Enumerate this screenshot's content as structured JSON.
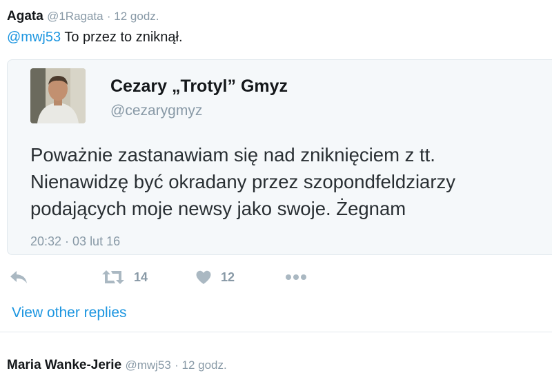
{
  "reply_tweet": {
    "author_name": "Agata",
    "author_handle": "@1Ragata",
    "time": "· 12 godz.",
    "mention": "@mwj53",
    "text": "To przez to zniknął."
  },
  "quoted_tweet": {
    "author_name": "Cezary „Trotyl” Gmyz",
    "author_handle": "@cezarygmyz",
    "body_lines": [
      "Poważnie zastanawiam się nad zniknięciem z tt.",
      "Nienawidzę być okradany przez szopondfeldziarzy",
      "podających moje newsy jako swoje. Żegnam"
    ],
    "timestamp": "20:32 · 03 lut 16"
  },
  "actions": {
    "reply_icon": "reply-icon",
    "retweet_icon": "retweet-icon",
    "retweet_count": "14",
    "like_icon": "heart-icon",
    "like_count": "12",
    "more_icon": "more-dots-icon"
  },
  "view_other_replies": "View other replies",
  "next_tweet": {
    "author_name": "Maria Wanke-Jerie",
    "author_handle": "@mwj53",
    "time": "· 12 godz."
  },
  "colors": {
    "link": "#1b95e0",
    "muted": "#8899a6",
    "card_bg": "#f5f8fa",
    "border": "#e1e8ed"
  }
}
